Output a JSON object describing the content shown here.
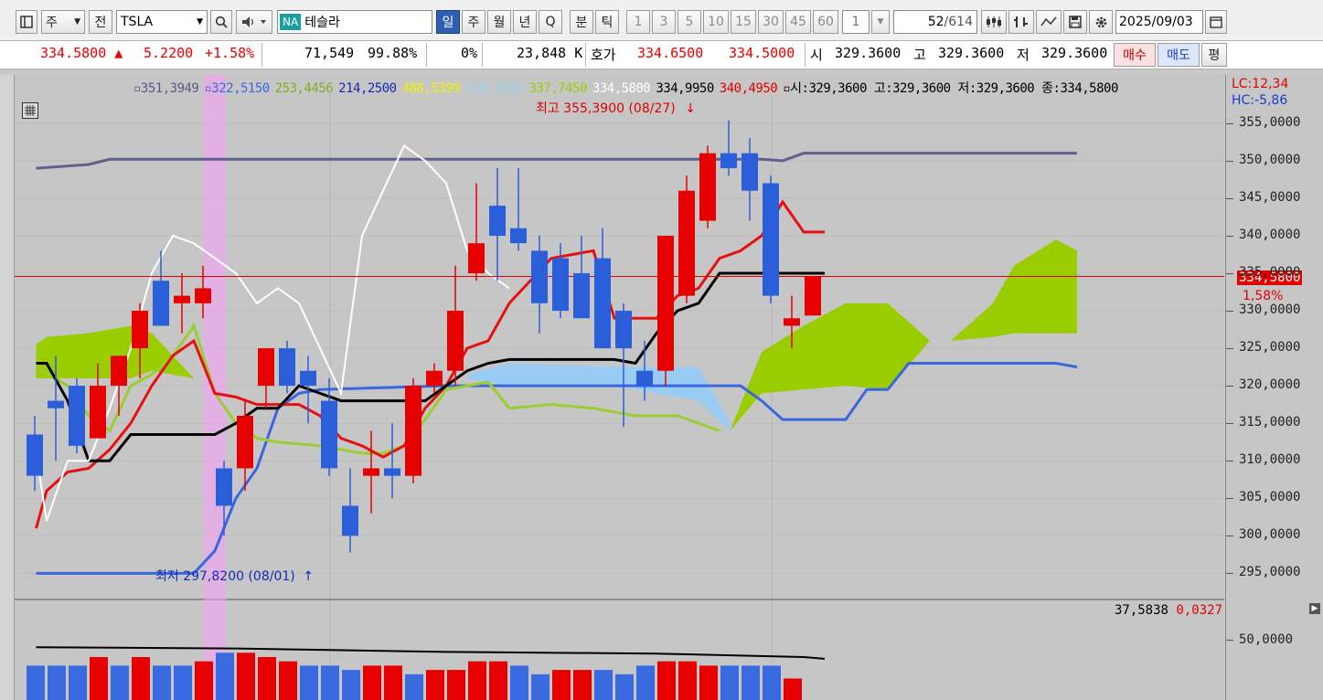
{
  "toolbar": {
    "type_label": "주",
    "market_label": "전",
    "symbol": "TSLA",
    "na_badge": "NA",
    "stock_name": "테슬라",
    "periods": [
      "일",
      "주",
      "월",
      "년",
      "Q",
      "분",
      "틱"
    ],
    "intervals": [
      "1",
      "3",
      "5",
      "10",
      "15",
      "30",
      "45",
      "60"
    ],
    "multiplier": "1",
    "page_count": "52",
    "page_total": "/614",
    "date": "2025/09/03"
  },
  "quote": {
    "price": "334.5800",
    "change": "5.2200",
    "change_pct": "+1.58%",
    "volume": "71,549",
    "ratio": "99.88%",
    "zero_pct": "0%",
    "amount": "23,848",
    "amount_unit": "K",
    "hoga_label": "호가",
    "ask": "334.6500",
    "bid": "334.5000",
    "open_label": "시",
    "open": "329.3600",
    "high_label": "고",
    "high": "329.3600",
    "low_label": "저",
    "low": "329.3600",
    "buy_button": "매수",
    "sell_button": "매도",
    "eval_button": "평"
  },
  "legend": {
    "values": [
      "351,3949",
      "322,5150",
      "253,4456",
      "214,2500",
      "488,5399",
      "329,3600",
      "337,7450",
      "334,5800",
      "334,9950",
      "340,4950"
    ],
    "colors": [
      "#5a5a8a",
      "#3a6ae0",
      "#7ab020",
      "#1a2ab0",
      "#f0f000",
      "#9ad0f0",
      "#9ad000",
      "#ffffff",
      "#000000",
      "#e00000"
    ],
    "ohlc": "시:329,3600 고:329,3600 저:329,3600 종:334,5800",
    "lc": "LC:12,34",
    "hc": "HC:-5,86"
  },
  "annotations": {
    "high_marker": "최고 355,3900 (08/27)",
    "low_marker": "최저 297,8200 (08/01)",
    "current_price": "334,5800",
    "current_pct": "1,58%"
  },
  "volume_panel": {
    "value": "37,5838",
    "change": "0,0327",
    "axis_label": "50,0000"
  },
  "chart_data": {
    "type": "candlestick",
    "y_ticks": [
      "355,0000",
      "350,0000",
      "345,0000",
      "340,0000",
      "335,0000",
      "330,0000",
      "325,0000",
      "320,0000",
      "315,0000",
      "310,0000",
      "305,0000",
      "300,0000",
      "295,0000"
    ],
    "ylim": [
      292,
      359
    ],
    "candles": [
      {
        "o": 313.5,
        "h": 316,
        "l": 306,
        "c": 308
      },
      {
        "o": 318,
        "h": 324,
        "l": 310,
        "c": 317
      },
      {
        "o": 320,
        "h": 321,
        "l": 311,
        "c": 312
      },
      {
        "o": 313,
        "h": 323,
        "l": 313,
        "c": 320
      },
      {
        "o": 320,
        "h": 324,
        "l": 316,
        "c": 324
      },
      {
        "o": 325,
        "h": 331,
        "l": 321,
        "c": 330
      },
      {
        "o": 334,
        "h": 338,
        "l": 329,
        "c": 328
      },
      {
        "o": 331,
        "h": 335,
        "l": 327,
        "c": 332
      },
      {
        "o": 331,
        "h": 336,
        "l": 329,
        "c": 333
      },
      {
        "o": 309,
        "h": 310,
        "l": 300,
        "c": 304
      },
      {
        "o": 309,
        "h": 318,
        "l": 306,
        "c": 316
      },
      {
        "o": 320,
        "h": 325,
        "l": 317,
        "c": 325
      },
      {
        "o": 325,
        "h": 326,
        "l": 319,
        "c": 320
      },
      {
        "o": 322,
        "h": 324,
        "l": 315,
        "c": 320
      },
      {
        "o": 318,
        "h": 321,
        "l": 308,
        "c": 309
      },
      {
        "o": 304,
        "h": 309,
        "l": 297.8,
        "c": 300
      },
      {
        "o": 308,
        "h": 314,
        "l": 303,
        "c": 309
      },
      {
        "o": 309,
        "h": 315,
        "l": 305,
        "c": 308
      },
      {
        "o": 308,
        "h": 321,
        "l": 307,
        "c": 320
      },
      {
        "o": 320,
        "h": 323,
        "l": 319,
        "c": 322
      },
      {
        "o": 322,
        "h": 336,
        "l": 320,
        "c": 330
      },
      {
        "o": 335,
        "h": 347,
        "l": 334,
        "c": 339
      },
      {
        "o": 344,
        "h": 349,
        "l": 334,
        "c": 340
      },
      {
        "o": 341,
        "h": 349,
        "l": 338,
        "c": 339
      },
      {
        "o": 338,
        "h": 340,
        "l": 327,
        "c": 331
      },
      {
        "o": 337,
        "h": 339,
        "l": 329,
        "c": 330
      },
      {
        "o": 335,
        "h": 340,
        "l": 331,
        "c": 329
      },
      {
        "o": 337,
        "h": 341,
        "l": 327,
        "c": 325
      },
      {
        "o": 330,
        "h": 331,
        "l": 314.5,
        "c": 325
      },
      {
        "o": 322,
        "h": 326,
        "l": 318,
        "c": 320
      },
      {
        "o": 322,
        "h": 340,
        "l": 320,
        "c": 340
      },
      {
        "o": 332,
        "h": 348,
        "l": 331,
        "c": 346
      },
      {
        "o": 342,
        "h": 352,
        "l": 341,
        "c": 351
      },
      {
        "o": 351,
        "h": 355.39,
        "l": 348,
        "c": 349
      },
      {
        "o": 351,
        "h": 353,
        "l": 342,
        "c": 346
      },
      {
        "o": 347,
        "h": 348,
        "l": 331,
        "c": 332
      },
      {
        "o": 328,
        "h": 332,
        "l": 325,
        "c": 329
      },
      {
        "o": 329.36,
        "h": 329.36,
        "l": 329.36,
        "c": 334.58
      }
    ],
    "volume": [
      46,
      46,
      46,
      48,
      46,
      48,
      46,
      46,
      47,
      49,
      49,
      48,
      47,
      46,
      46,
      45,
      46,
      46,
      44,
      45,
      45,
      47,
      47,
      46,
      44,
      45,
      45,
      45,
      44,
      46,
      47,
      47,
      46,
      46,
      46,
      46,
      43,
      0
    ],
    "volume_up": [
      false,
      false,
      false,
      true,
      false,
      true,
      false,
      false,
      true,
      false,
      true,
      true,
      true,
      false,
      false,
      false,
      true,
      true,
      false,
      true,
      true,
      true,
      true,
      false,
      false,
      true,
      true,
      false,
      false,
      false,
      true,
      true,
      true,
      false,
      false,
      false,
      true,
      true
    ],
    "current_price": 334.58
  }
}
